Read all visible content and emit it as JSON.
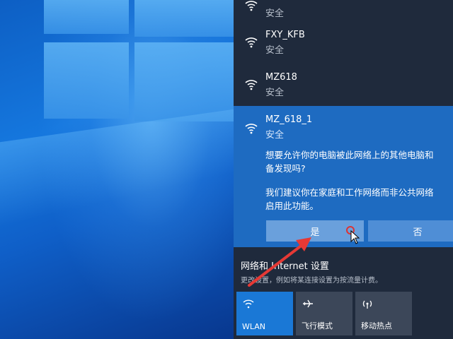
{
  "networks": [
    {
      "ssid": "",
      "status": "安全"
    },
    {
      "ssid": "FXY_KFB",
      "status": "安全"
    },
    {
      "ssid": "MZ618",
      "status": "安全"
    }
  ],
  "selected_network": {
    "ssid": "MZ_618_1",
    "status": "安全",
    "prompt_line1": "想要允许你的电脑被此网络上的其他电脑和",
    "prompt_line2": "备发现吗?",
    "prompt_line3": "我们建议你在家庭和工作网络而非公共网络",
    "prompt_line4": "启用此功能。",
    "yes_label": "是",
    "no_label": "否"
  },
  "settings": {
    "link_label": "网络和 Internet 设置",
    "description": "更改设置，例如将某连接设置为按流量计费。"
  },
  "quick_actions": [
    {
      "label": "WLAN",
      "icon": "wifi-icon",
      "active": true
    },
    {
      "label": "飞行模式",
      "icon": "airplane-icon",
      "active": false
    },
    {
      "label": "移动热点",
      "icon": "hotspot-icon",
      "active": false
    }
  ],
  "colors": {
    "panel_bg": "#1f2a3c",
    "selected_bg": "#1e6bc1",
    "accent": "#1a78d6",
    "annotation_arrow": "#e53935"
  }
}
